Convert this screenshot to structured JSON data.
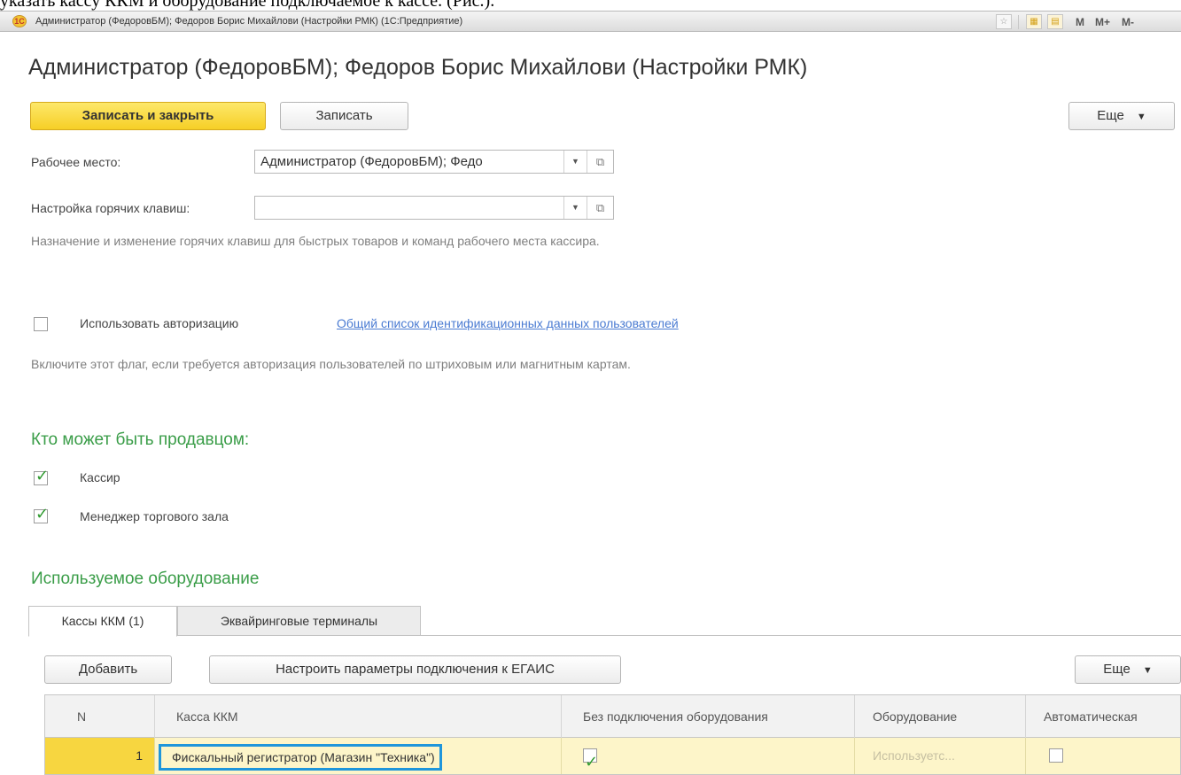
{
  "document": {
    "text_above": "указать кассу ККМ и оборудование подключаемое к кассе. (Рис.)."
  },
  "window": {
    "title": "Администратор (ФедоровБМ); Федоров Борис Михайлови (Настройки РМК)  (1С:Предприятие)",
    "tray_buttons": [
      "M",
      "M+",
      "M-"
    ]
  },
  "form": {
    "title": "Администратор (ФедоровБМ); Федоров Борис Михайлови (Настройки РМК)",
    "toolbar": {
      "save_close_label": "Записать и закрыть",
      "save_label": "Записать",
      "more_label": "Еще"
    },
    "workplace": {
      "label": "Рабочее место:",
      "value": "Администратор (ФедоровБМ); Федо"
    },
    "hotkeys": {
      "label": "Настройка горячих клавиш:",
      "value": "",
      "hint": "Назначение и изменение горячих клавиш для быстрых товаров и команд рабочего места кассира."
    },
    "authorization": {
      "label": "Использовать авторизацию",
      "checked": false,
      "link": "Общий список идентификационных данных пользователей",
      "hint": "Включите этот флаг, если требуется авторизация пользователей по штриховым или магнитным картам."
    },
    "sellers": {
      "title": "Кто может быть продавцом:",
      "options": [
        {
          "label": "Кассир",
          "checked": true
        },
        {
          "label": "Менеджер торгового зала",
          "checked": true
        }
      ]
    },
    "equipment": {
      "title": "Используемое оборудование",
      "tabs": [
        "Кассы ККМ (1)",
        "Эквайринговые терминалы"
      ],
      "active_tab": 0,
      "toolbar": {
        "add_label": "Добавить",
        "egais_label": "Настроить параметры подключения к ЕГАИС",
        "more_label": "Еще"
      },
      "table": {
        "columns": [
          "N",
          "Касса ККМ",
          "Без подключения оборудования",
          "Оборудование",
          "Автоматическая"
        ],
        "rows": [
          {
            "n": "1",
            "kassa": "Фискальный регистратор (Магазин \"Техника\")",
            "no_equipment": true,
            "equipment": "Используетс...",
            "automatic": false
          }
        ]
      }
    }
  },
  "colors": {
    "primary_button": "#f6cf26",
    "section_title": "#3a9d48",
    "link": "#4a7bd2",
    "row_highlight": "#fdf5c9",
    "selection_border": "#1f96db",
    "checkmark": "#2e9a2e"
  }
}
